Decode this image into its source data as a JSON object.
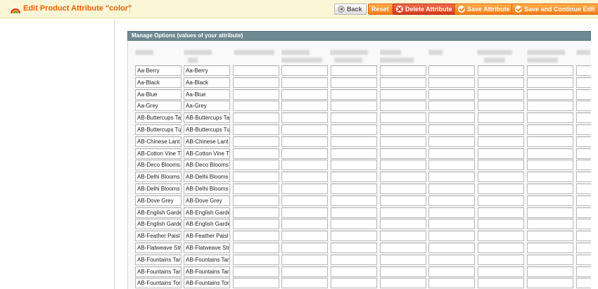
{
  "header": {
    "title": "Edit Product Attribute \"color\"",
    "buttons": {
      "back": "Back",
      "reset": "Reset",
      "delete": "Delete Attribute",
      "save": "Save Attribute",
      "save_continue": "Save and Continue Edit"
    }
  },
  "panel": {
    "title": "Manage Options (values of your attribute)"
  },
  "options": [
    {
      "admin": "Aa-Berry",
      "default": "Aa-Berry"
    },
    {
      "admin": "Aa-Black",
      "default": "Aa-Black"
    },
    {
      "admin": "Aa-Blue",
      "default": "Aa-Blue"
    },
    {
      "admin": "Aa-Grey",
      "default": "Aa-Grey"
    },
    {
      "admin": "AB-Buttercups Ta",
      "default": "AB-Buttercups Ta"
    },
    {
      "admin": "AB-Buttercups Tu",
      "default": "AB-Buttercups Tu"
    },
    {
      "admin": "AB-Chinese Lant",
      "default": "AB-Chinese Lant"
    },
    {
      "admin": "AB-Cotton Vine T",
      "default": "AB-Cotton Vine T"
    },
    {
      "admin": "AB-Deco Blooms",
      "default": "AB-Deco Blooms"
    },
    {
      "admin": "AB-Delhi Blooms",
      "default": "AB-Delhi Blooms"
    },
    {
      "admin": "AB-Delhi Blooms",
      "default": "AB-Delhi Blooms"
    },
    {
      "admin": "AB-Dove Grey",
      "default": "AB-Dove Grey"
    },
    {
      "admin": "AB-English Garde",
      "default": "AB-English Garde"
    },
    {
      "admin": "AB-English Garde",
      "default": "AB-English Garde"
    },
    {
      "admin": "AB-Feather Paisl",
      "default": "AB-Feather Paisl"
    },
    {
      "admin": "AB-Flatweave Str",
      "default": "AB-Flatweave Str"
    },
    {
      "admin": "AB-Fountains Tar",
      "default": "AB-Fountains Tar"
    },
    {
      "admin": "AB-Fountains Tar",
      "default": "AB-Fountains Tar"
    },
    {
      "admin": "AB-Fountains Tor",
      "default": "AB-Fountains Tor"
    }
  ],
  "colors": {
    "title": "#eb5e00",
    "header_bg": "#fbf7d6",
    "panel_head_bg": "#6f8992",
    "button_orange": "#f77c16",
    "button_red": "#d43a1a"
  }
}
